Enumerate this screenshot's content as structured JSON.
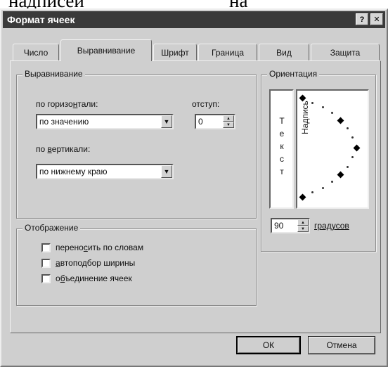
{
  "above": {
    "left": "надписей",
    "right": "на"
  },
  "window": {
    "title": "Формат ячеек",
    "help_label": "?",
    "close_label": "✕"
  },
  "tabs": [
    {
      "label": "Число",
      "active": false
    },
    {
      "label": "Выравнивание",
      "active": true
    },
    {
      "label": "Шрифт",
      "active": false
    },
    {
      "label": "Граница",
      "active": false
    },
    {
      "label": "Вид",
      "active": false
    },
    {
      "label": "Защита",
      "active": false
    }
  ],
  "alignment": {
    "legend": "Выравнивание",
    "horizontal": {
      "label_pre": "по горизо",
      "label_u": "н",
      "label_post": "тали:",
      "value": "по значению"
    },
    "indent": {
      "label": "отступ:",
      "value": "0"
    },
    "vertical": {
      "label_pre": "по ",
      "label_u": "в",
      "label_post": "ертикали:",
      "value": "по нижнему краю"
    }
  },
  "orientation": {
    "legend": "Ориентация",
    "vertical_text": [
      "Т",
      "е",
      "к",
      "с",
      "т"
    ],
    "dial_text": "Надпись",
    "degrees_value": "90",
    "degrees_label": "градусов"
  },
  "display": {
    "legend": "Отображение",
    "options": [
      {
        "label_pre": "перено",
        "label_u": "с",
        "label_post": "ить по словам",
        "checked": false
      },
      {
        "label_pre": "",
        "label_u": "а",
        "label_post": "втоподбор ширины",
        "checked": false
      },
      {
        "label_pre": "о",
        "label_u": "б",
        "label_post": "ъединение ячеек",
        "checked": false
      }
    ]
  },
  "buttons": {
    "ok": "ОК",
    "cancel": "Отмена"
  },
  "icons": {
    "combo_arrow": "chevron-down-icon",
    "spin_up": "arrow-up-icon",
    "spin_down": "arrow-down-icon"
  }
}
